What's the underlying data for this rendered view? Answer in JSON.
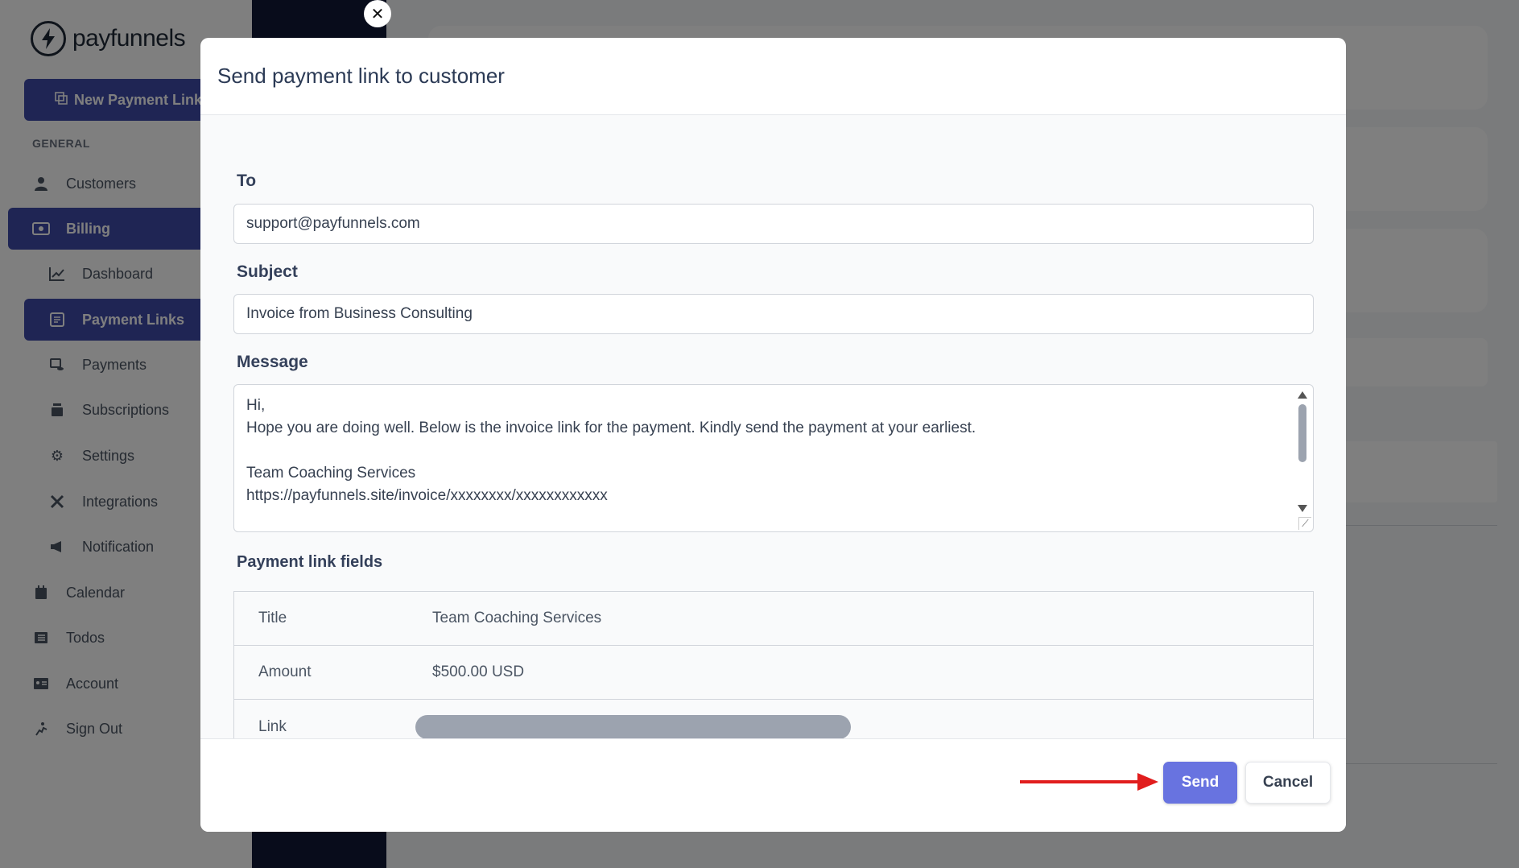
{
  "brand": {
    "name": "payfunnels"
  },
  "sidebar": {
    "new_button_label": "New Payment Link",
    "section_label": "GENERAL",
    "items": [
      {
        "label": "Customers",
        "icon": "user-icon"
      },
      {
        "label": "Billing",
        "icon": "cash-icon"
      },
      {
        "label": "Dashboard",
        "icon": "chart-line-icon"
      },
      {
        "label": "Payment Links",
        "icon": "link-doc-icon"
      },
      {
        "label": "Payments",
        "icon": "coins-icon"
      },
      {
        "label": "Subscriptions",
        "icon": "stack-icon"
      },
      {
        "label": "Settings",
        "icon": "gear-icon"
      },
      {
        "label": "Integrations",
        "icon": "tools-icon"
      },
      {
        "label": "Notification",
        "icon": "megaphone-icon"
      },
      {
        "label": "Calendar",
        "icon": "calendar-icon"
      },
      {
        "label": "Todos",
        "icon": "list-icon"
      },
      {
        "label": "Account",
        "icon": "id-card-icon"
      },
      {
        "label": "Sign Out",
        "icon": "sign-out-icon"
      }
    ]
  },
  "modal": {
    "title": "Send payment link to customer",
    "to": {
      "label": "To",
      "value": "support@payfunnels.com"
    },
    "subject": {
      "label": "Subject",
      "value": "Invoice from Business Consulting"
    },
    "message": {
      "label": "Message",
      "lines": [
        "Hi,",
        "Hope you are doing well. Below is the invoice link for the payment. Kindly send the payment at your earliest.",
        "",
        "Team Coaching Services",
        "https://payfunnels.site/invoice/xxxxxxxx/xxxxxxxxxxxx"
      ]
    },
    "fields_heading": "Payment link fields",
    "fields": [
      {
        "key": "Title",
        "value": "Team Coaching Services"
      },
      {
        "key": "Amount",
        "value": "$500.00 USD"
      },
      {
        "key": "Link",
        "value": ""
      }
    ],
    "send_label": "Send",
    "cancel_label": "Cancel"
  },
  "colors": {
    "primary": "#3f4aa8",
    "send_button": "#6873e0",
    "annotation_arrow": "#e11d1d"
  }
}
